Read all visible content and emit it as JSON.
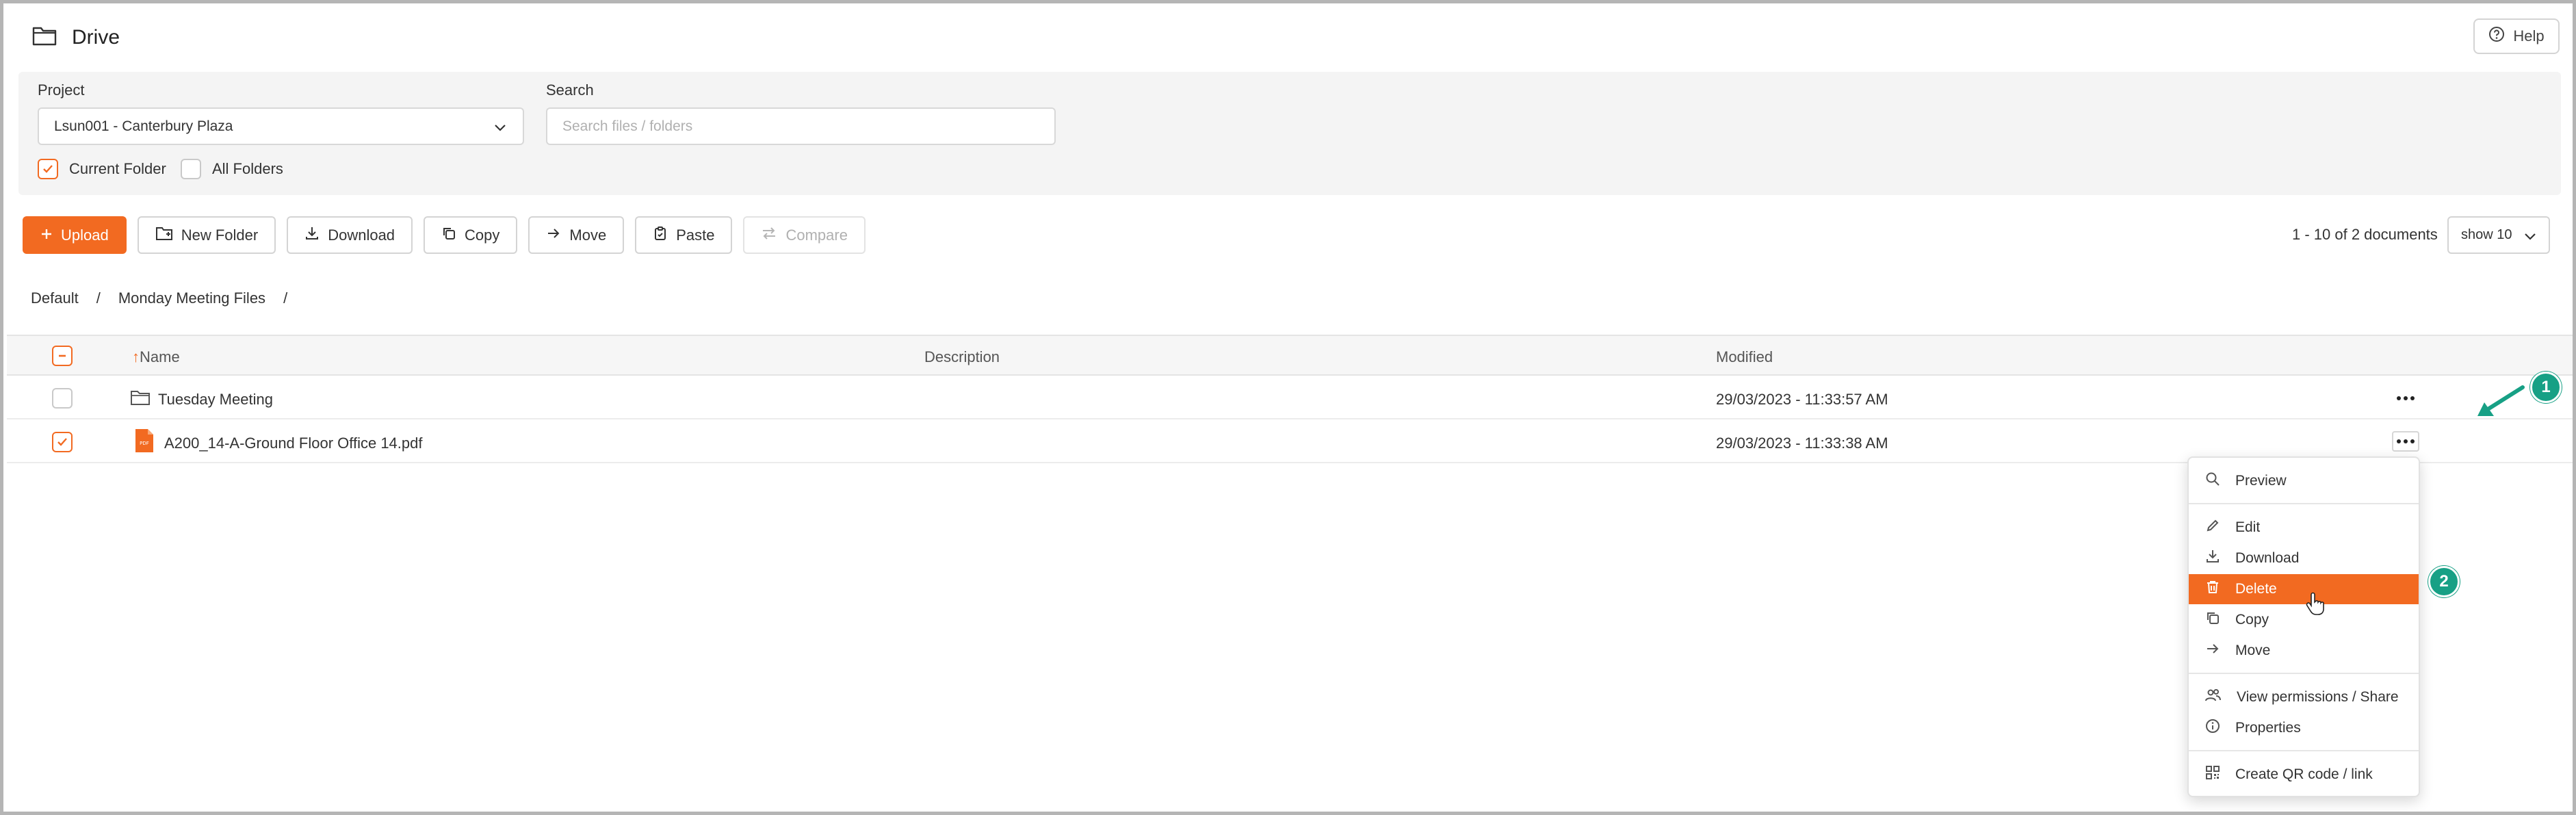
{
  "header": {
    "title": "Drive",
    "help_label": "Help"
  },
  "filters": {
    "project_label": "Project",
    "project_value": "Lsun001 - Canterbury Plaza",
    "search_label": "Search",
    "search_placeholder": "Search files / folders",
    "current_folder_label": "Current Folder",
    "current_folder_checked": true,
    "all_folders_label": "All Folders",
    "all_folders_checked": false
  },
  "toolbar": {
    "upload": "Upload",
    "new_folder": "New Folder",
    "download": "Download",
    "copy": "Copy",
    "move": "Move",
    "paste": "Paste",
    "compare": "Compare",
    "count_text": "1 - 10 of 2 documents",
    "show_value": "show 10"
  },
  "breadcrumb": {
    "items": [
      "Default",
      "/",
      "Monday Meeting Files",
      "/"
    ]
  },
  "table": {
    "columns": {
      "name": "Name",
      "name_sort_indicator": "↑",
      "description": "Description",
      "modified": "Modified"
    },
    "rows": [
      {
        "type": "folder",
        "name": "Tuesday Meeting",
        "description": "",
        "modified": "29/03/2023 - 11:33:57 AM",
        "checked": false
      },
      {
        "type": "pdf",
        "name": "A200_14-A-Ground Floor Office 14.pdf",
        "description": "",
        "modified": "29/03/2023 - 11:33:38 AM",
        "checked": true
      }
    ]
  },
  "context_menu": {
    "items": [
      {
        "label": "Preview",
        "icon": "search-icon"
      },
      {
        "label": "Edit",
        "icon": "pencil-icon"
      },
      {
        "label": "Download",
        "icon": "download-icon"
      },
      {
        "label": "Delete",
        "icon": "trash-icon",
        "highlighted": true
      },
      {
        "label": "Copy",
        "icon": "copy-icon"
      },
      {
        "label": "Move",
        "icon": "arrow-right-icon"
      },
      {
        "label": "View permissions / Share",
        "icon": "users-icon"
      },
      {
        "label": "Properties",
        "icon": "info-icon"
      },
      {
        "label": "Create QR code / link",
        "icon": "qr-code-icon"
      }
    ]
  },
  "annotations": {
    "step1": "1",
    "step2": "2"
  },
  "colors": {
    "accent": "#f26a21",
    "annotation": "#17a085"
  }
}
